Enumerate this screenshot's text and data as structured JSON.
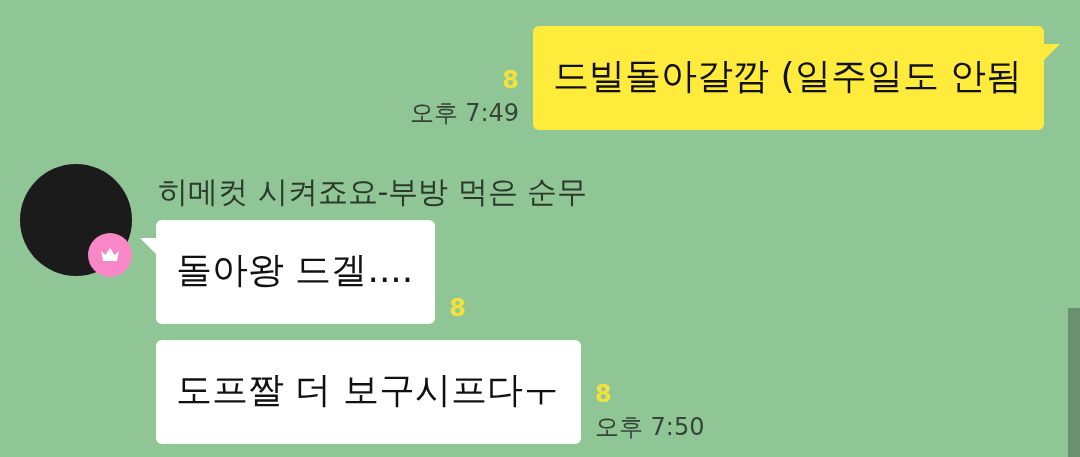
{
  "messages": [
    {
      "kind": "outgoing",
      "text": "드빌돌아갈깜 (일주일도 안됨",
      "unread": "8",
      "time": "오후 7:49"
    },
    {
      "kind": "incoming",
      "sender": "히메컷 시켜죠요-부방 먹은 순무",
      "text": "돌아왕 드겔....",
      "unread": "8"
    },
    {
      "kind": "incoming",
      "text": "도프짤 더 보구시프다ㅜ",
      "unread": "8",
      "time": "오후 7:50"
    }
  ]
}
